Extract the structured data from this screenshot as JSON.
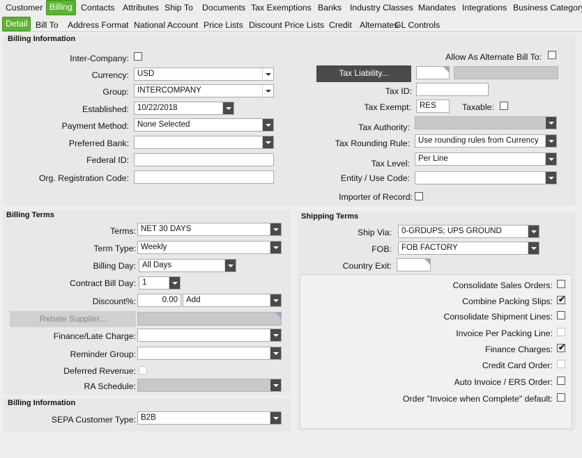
{
  "tabs_top": [
    "Customer",
    "Billing",
    "Contacts",
    "Attributes",
    "Ship To",
    "Documents",
    "Tax Exemptions",
    "Banks",
    "Industry Classes",
    "Mandates",
    "Integrations",
    "Business Category"
  ],
  "tabs_sub": [
    "Detail",
    "Bill To",
    "Address Format",
    "National Account",
    "Price Lists",
    "Discount Price Lists",
    "Credit",
    "Alternates",
    "GL Controls"
  ],
  "billing_info": {
    "title": "Billing Information",
    "inter_company": "Inter-Company:",
    "currency_label": "Currency:",
    "currency_value": "USD",
    "group_label": "Group:",
    "group_value": "INTERCOMPANY",
    "established_label": "Established:",
    "established_value": "10/22/2018",
    "payment_method_label": "Payment Method:",
    "payment_method_value": "None Selected",
    "preferred_bank_label": "Preferred Bank:",
    "federal_id_label": "Federal ID:",
    "org_reg_label": "Org. Registration Code:",
    "allow_alt_label": "Allow As Alternate Bill To:",
    "tax_liability_button": "Tax Liability...",
    "tax_id_label": "Tax ID:",
    "tax_exempt_label": "Tax Exempt:",
    "tax_exempt_value": "RES",
    "taxable_label": "Taxable:",
    "tax_authority_label": "Tax Authority:",
    "tax_rounding_label": "Tax Rounding Rule:",
    "tax_rounding_value": "Use rounding rules from Currency",
    "tax_level_label": "Tax Level:",
    "tax_level_value": "Per Line",
    "entity_use_label": "Entity / Use Code:",
    "importer_label": "Importer of Record:"
  },
  "billing_terms": {
    "title": "Billing Terms",
    "terms_label": "Terms:",
    "terms_value": "NET  30 DAYS",
    "term_type_label": "Term Type:",
    "term_type_value": "Weekly",
    "billing_day_label": "Billing Day:",
    "billing_day_value": "All Days",
    "contract_bill_day_label": "Contract Bill Day:",
    "contract_bill_day_value": "1",
    "discount_label": "Discount%:",
    "discount_value": "0.00",
    "discount_mode": "Add",
    "rebate_button": "Rebate Supplier...",
    "finance_label": "Finance/Late Charge:",
    "reminder_label": "Reminder Group:",
    "deferred_label": "Deferred Revenue:",
    "ra_label": "RA Schedule:"
  },
  "billing_info2": {
    "title": "Billing Information",
    "sepa_label": "SEPA Customer Type:",
    "sepa_value": "B2B"
  },
  "shipping_terms": {
    "title": "Shipping Terms",
    "ship_via_label": "Ship Via:",
    "ship_via_value": "0-GRDUPS; UPS GROUND",
    "fob_label": "FOB:",
    "fob_value": "FOB FACTORY",
    "country_exit_label": "Country Exit:",
    "options": [
      {
        "label": "Consolidate Sales Orders:",
        "checked": false,
        "disabled": false
      },
      {
        "label": "Combine Packing Slips:",
        "checked": true,
        "disabled": false
      },
      {
        "label": "Consolidate Shipment Lines:",
        "checked": false,
        "disabled": false
      },
      {
        "label": "Invoice Per Packing Line:",
        "checked": false,
        "disabled": true
      },
      {
        "label": "Finance Charges:",
        "checked": true,
        "disabled": false
      },
      {
        "label": "Credit Card Order:",
        "checked": false,
        "disabled": true
      },
      {
        "label": "Auto Invoice / ERS Order:",
        "checked": false,
        "disabled": false
      },
      {
        "label": "Order \"Invoice when Complete\" default:",
        "checked": false,
        "disabled": false
      }
    ]
  },
  "colors": {
    "accent": "#5cb531",
    "button_dark": "#4a4a4a"
  }
}
